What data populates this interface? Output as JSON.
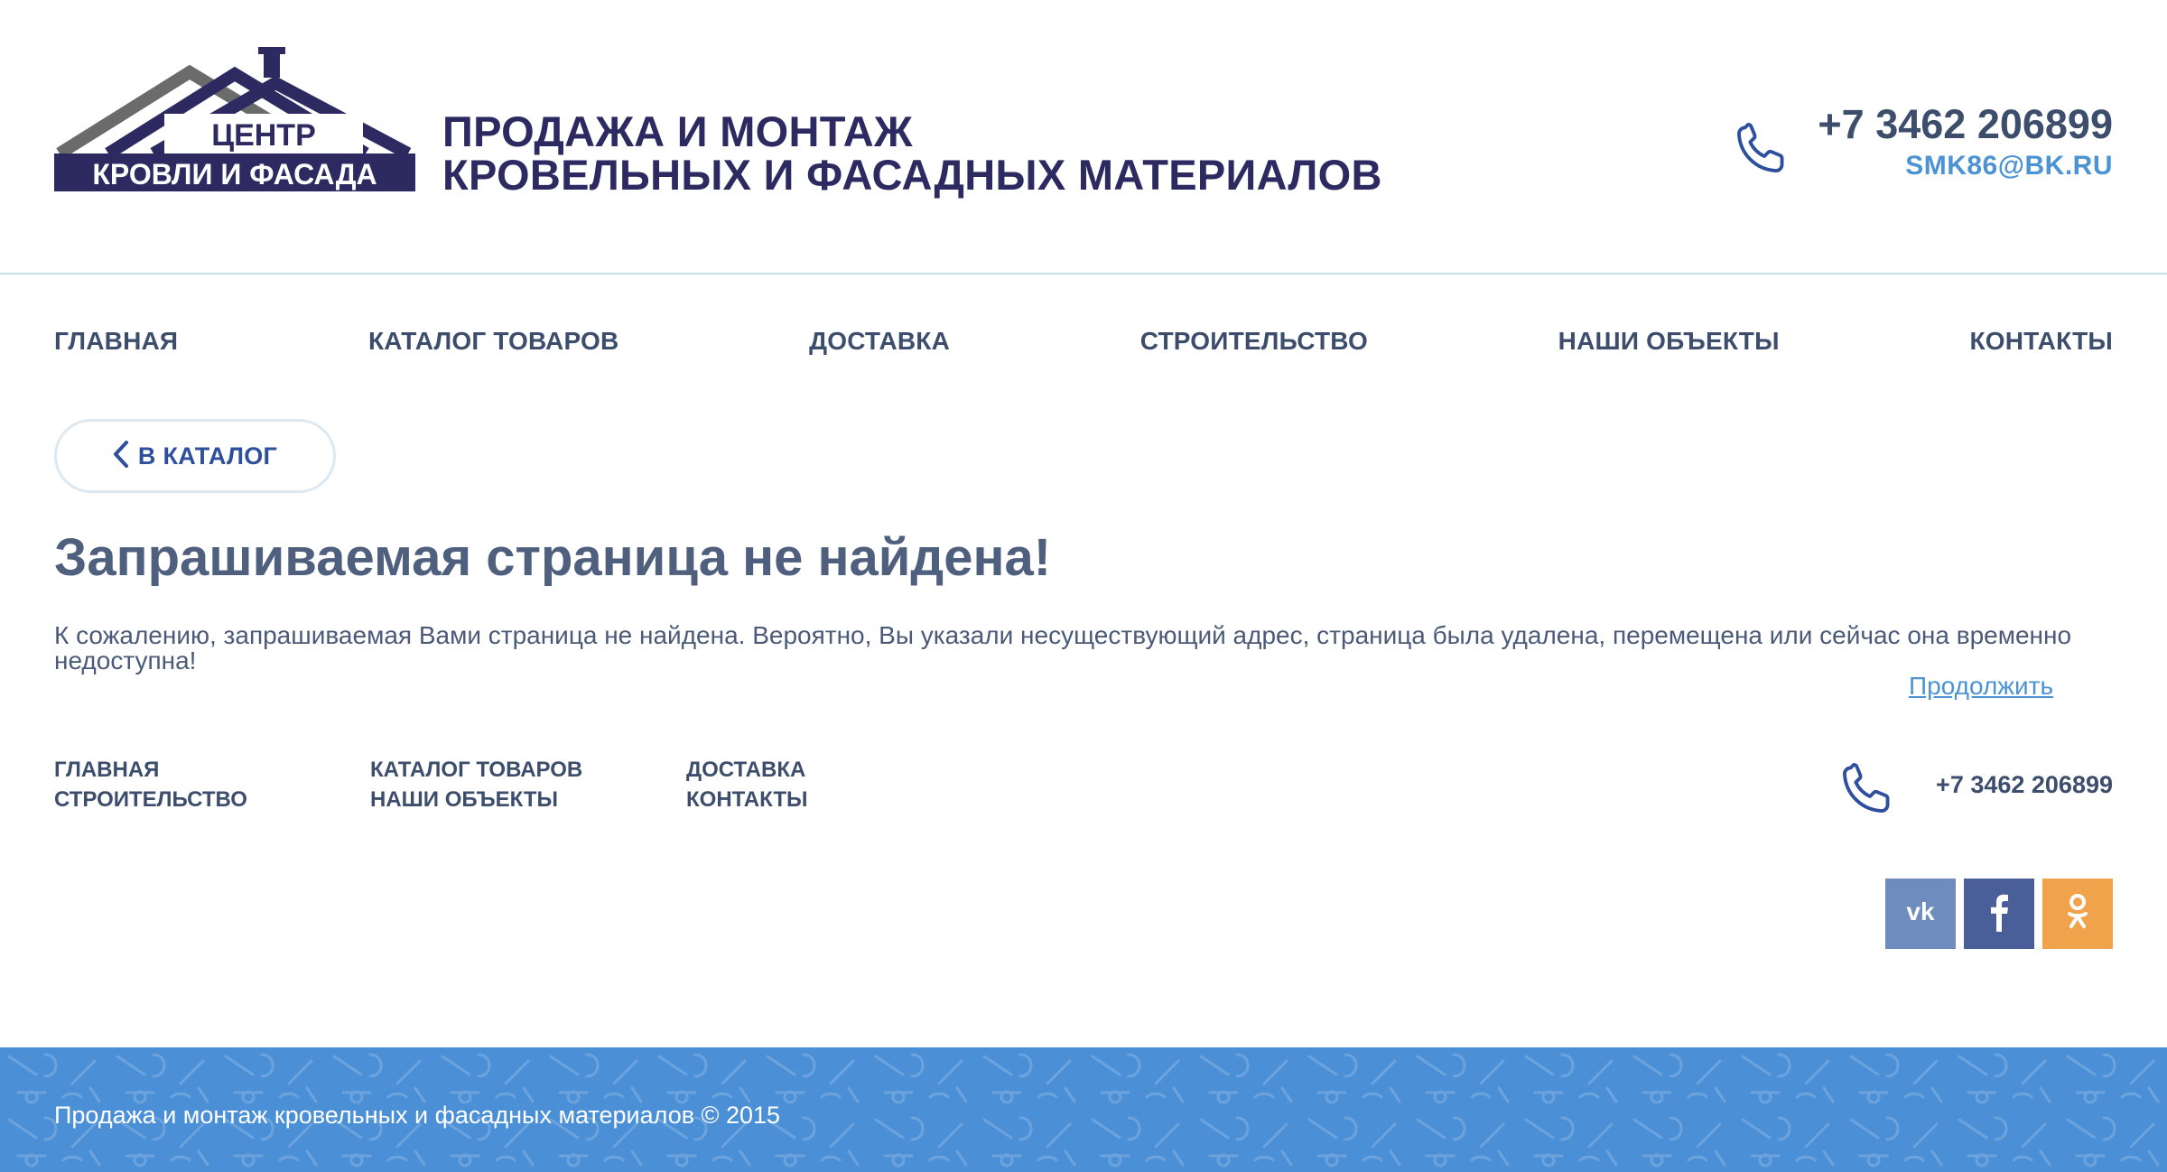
{
  "header": {
    "logo": {
      "line1": "ЦЕНТР",
      "line2": "КРОВЛИ И ФАСАДА"
    },
    "tagline_line1": "ПРОДАЖА И МОНТАЖ",
    "tagline_line2": "КРОВЕЛЬНЫХ И ФАСАДНЫХ МАТЕРИАЛОВ",
    "phone": "+7 3462 206899",
    "email": "SMK86@BK.RU"
  },
  "nav": {
    "items": [
      "ГЛАВНАЯ",
      "КАТАЛОГ ТОВАРОВ",
      "ДОСТАВКА",
      "СТРОИТЕЛЬСТВО",
      "НАШИ ОБЪЕКТЫ",
      "КОНТАКТЫ"
    ]
  },
  "back_button": {
    "label": "В КАТАЛОГ"
  },
  "content": {
    "title": "Запрашиваемая страница не найдена!",
    "text": "К сожалению, запрашиваемая Вами страница не найдена. Вероятно, Вы указали несуществующий адрес, страница была удалена, перемещена или сейчас она временно недоступна!",
    "continue_link": "Продолжить"
  },
  "footer": {
    "menu": [
      [
        "ГЛАВНАЯ",
        "СТРОИТЕЛЬСТВО"
      ],
      [
        "КАТАЛОГ ТОВАРОВ",
        "НАШИ ОБЪЕКТЫ"
      ],
      [
        "ДОСТАВКА",
        "КОНТАКТЫ"
      ]
    ],
    "phone": "+7 3462 206899",
    "social": [
      {
        "name": "vk",
        "icon": "vk-icon",
        "color": "#6e8cbd"
      },
      {
        "name": "facebook",
        "icon": "facebook-icon",
        "color": "#4a5f9a"
      },
      {
        "name": "odnoklassniki",
        "icon": "odnoklassniki-icon",
        "color": "#f0a34b"
      }
    ],
    "copyright": "Продажа и монтаж кровельных и фасадных материалов © 2015"
  },
  "colors": {
    "brand_dark": "#2c2a60",
    "accent_blue": "#4b93d3",
    "text": "#4a5a78",
    "bottom_bar": "#4b8fd6"
  }
}
